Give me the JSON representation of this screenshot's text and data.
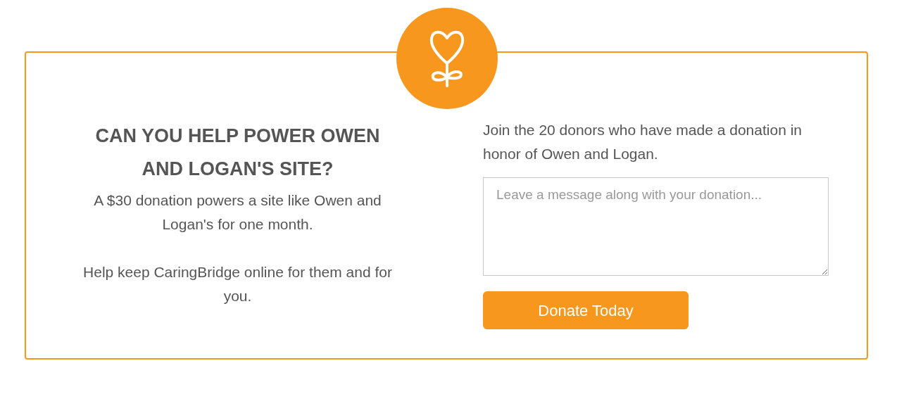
{
  "heading": "CAN YOU HELP POWER OWEN AND LOGAN'S SITE?",
  "paragraphs": [
    "A $30 donation powers a site like Owen and Logan's for one month.",
    "Help keep CaringBridge online for them and for you."
  ],
  "donors_text": "Join the 20 donors who have made a donation in honor of Owen and Logan.",
  "message": {
    "placeholder": "Leave a message along with your donation..."
  },
  "button": "Donate Today"
}
